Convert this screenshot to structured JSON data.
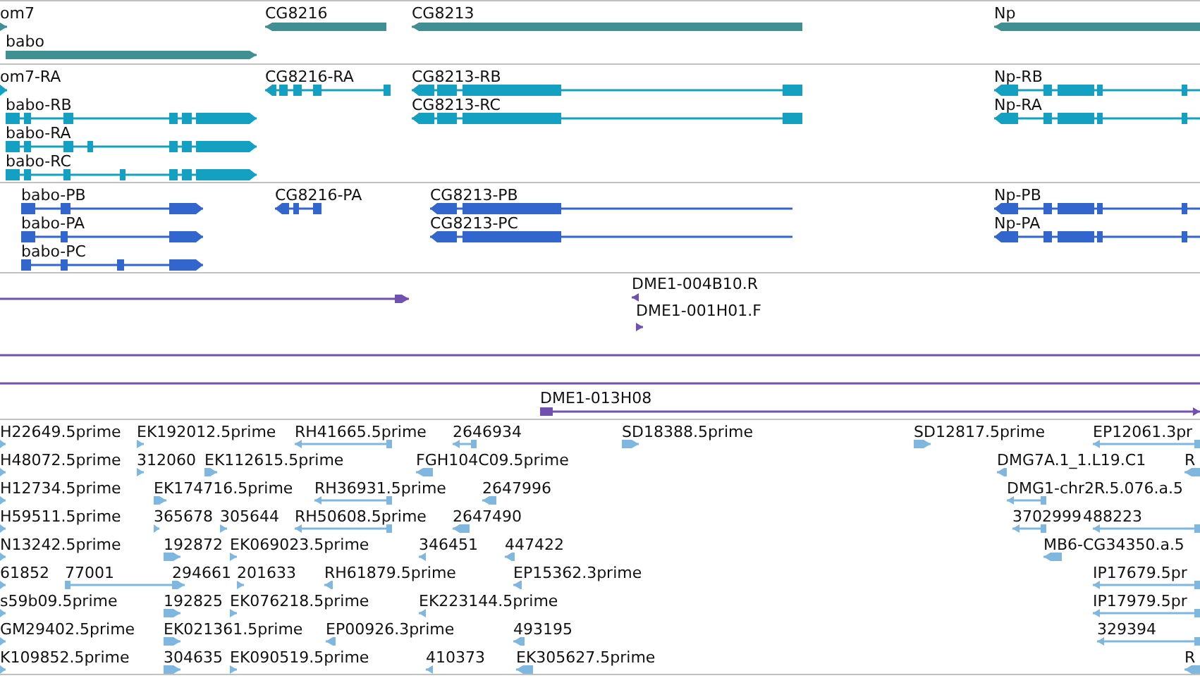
{
  "tracks": [
    {
      "kind": "gene",
      "features": [
        {
          "label": "om7",
          "reverse": false
        },
        {
          "label": "babo",
          "reverse": false
        },
        {
          "label": "CG8216",
          "reverse": true
        },
        {
          "label": "CG8213",
          "reverse": true
        },
        {
          "label": "Np",
          "reverse": true
        }
      ]
    },
    {
      "kind": "transcript",
      "features": [
        {
          "label": "om7-RA",
          "reverse": false
        },
        {
          "label": "babo-RB",
          "reverse": false
        },
        {
          "label": "babo-RA",
          "reverse": false
        },
        {
          "label": "babo-RC",
          "reverse": false
        },
        {
          "label": "CG8216-RA",
          "reverse": true
        },
        {
          "label": "CG8213-RB",
          "reverse": true
        },
        {
          "label": "CG8213-RC",
          "reverse": true
        },
        {
          "label": "Np-RB",
          "reverse": true
        },
        {
          "label": "Np-RA",
          "reverse": true
        }
      ]
    },
    {
      "kind": "protein",
      "features": [
        {
          "label": "babo-PB",
          "reverse": false
        },
        {
          "label": "babo-PA",
          "reverse": false
        },
        {
          "label": "babo-PC",
          "reverse": false
        },
        {
          "label": "CG8216-PA",
          "reverse": true
        },
        {
          "label": "CG8213-PB",
          "reverse": true
        },
        {
          "label": "CG8213-PC",
          "reverse": true
        },
        {
          "label": "Np-PB",
          "reverse": true
        },
        {
          "label": "Np-PA",
          "reverse": true
        }
      ]
    },
    {
      "kind": "clone",
      "features": [
        {
          "kind": "arrow",
          "reverse": false
        },
        {
          "kind": "arrow",
          "label": "DME1-004B10.R",
          "reverse": true
        },
        {
          "kind": "arrow",
          "label": "DME1-001H01.F",
          "reverse": false
        },
        {
          "kind": "line"
        },
        {
          "kind": "line"
        },
        {
          "kind": "arrow",
          "label": "DME1-013H08",
          "reverse": false
        }
      ]
    },
    {
      "kind": "est",
      "features": [
        {
          "label": "H22649.5prime",
          "reverse": false
        },
        {
          "label": "EK192012.5prime",
          "reverse": false
        },
        {
          "label": "RH41665.5prime",
          "reverse": true
        },
        {
          "label": "2646934",
          "reverse": true
        },
        {
          "label": "SD18388.5prime",
          "reverse": false
        },
        {
          "label": "SD12817.5prime",
          "reverse": false
        },
        {
          "label": "EP12061.3pr",
          "reverse": true
        },
        {
          "label": "H48072.5prime",
          "reverse": false
        },
        {
          "label": "312060",
          "reverse": false
        },
        {
          "label": "EK112615.5prime",
          "reverse": false
        },
        {
          "label": "FGH104C09.5prime",
          "reverse": true
        },
        {
          "label": "DMG7A.1_1.L19.C1",
          "reverse": true
        },
        {
          "label": "R",
          "reverse": true
        },
        {
          "label": "H12734.5prime",
          "reverse": false
        },
        {
          "label": "EK174716.5prime",
          "reverse": false
        },
        {
          "label": "RH36931.5prime",
          "reverse": true
        },
        {
          "label": "2647996",
          "reverse": true
        },
        {
          "label": "DMG1-chr2R.5.076.a.5",
          "reverse": true
        },
        {
          "label": "H59511.5prime",
          "reverse": false
        },
        {
          "label": "365678",
          "reverse": false
        },
        {
          "label": "305644",
          "reverse": false
        },
        {
          "label": "RH50608.5prime",
          "reverse": true
        },
        {
          "label": "2647490",
          "reverse": true
        },
        {
          "label": "3702999",
          "reverse": true
        },
        {
          "label": "488223",
          "reverse": true
        },
        {
          "label": "N13242.5prime",
          "reverse": false
        },
        {
          "label": "192872",
          "reverse": false
        },
        {
          "label": "EK069023.5prime",
          "reverse": false
        },
        {
          "label": "346451",
          "reverse": true
        },
        {
          "label": "447422",
          "reverse": true
        },
        {
          "label": "MB6-CG34350.a.5",
          "reverse": true
        },
        {
          "label": "61852",
          "reverse": false
        },
        {
          "label": "77001",
          "reverse": false
        },
        {
          "label": "294661",
          "reverse": false
        },
        {
          "label": "201633",
          "reverse": false
        },
        {
          "label": "RH61879.5prime",
          "reverse": true
        },
        {
          "label": "EP15362.3prime",
          "reverse": true
        },
        {
          "label": "IP17679.5pr",
          "reverse": true
        },
        {
          "label": "s59b09.5prime",
          "reverse": false
        },
        {
          "label": "192825",
          "reverse": false
        },
        {
          "label": "EK076218.5prime",
          "reverse": false
        },
        {
          "label": "EK223144.5prime",
          "reverse": true
        },
        {
          "label": "IP17979.5pr",
          "reverse": true
        },
        {
          "label": "GM29402.5prime",
          "reverse": false
        },
        {
          "label": "EK021361.5prime",
          "reverse": false
        },
        {
          "label": "EP00926.3prime",
          "reverse": true
        },
        {
          "label": "493195",
          "reverse": true
        },
        {
          "label": "329394",
          "reverse": true
        },
        {
          "label": "K109852.5prime",
          "reverse": false
        },
        {
          "label": "304635",
          "reverse": false
        },
        {
          "label": "EK090519.5prime",
          "reverse": false
        },
        {
          "label": "410373",
          "reverse": true
        },
        {
          "label": "EK305627.5prime",
          "reverse": true
        },
        {
          "label": "R",
          "reverse": true
        }
      ]
    }
  ]
}
